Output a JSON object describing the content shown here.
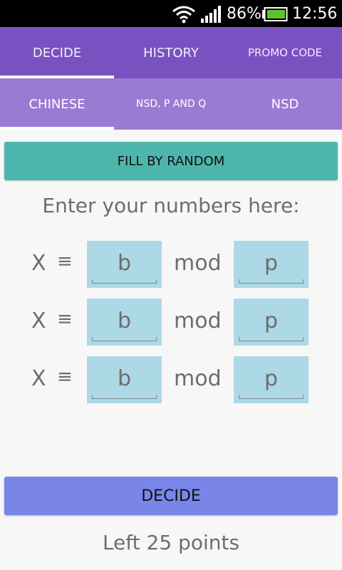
{
  "status_bar": {
    "battery_percent": "86%",
    "time": "12:56",
    "icons": [
      "wifi-icon",
      "signal-icon",
      "battery-icon"
    ]
  },
  "top_tabs": [
    {
      "label": "DECIDE",
      "active": true
    },
    {
      "label": "HISTORY",
      "active": false
    },
    {
      "label": "PROMO CODE",
      "active": false
    }
  ],
  "sub_tabs": [
    {
      "label": "CHINESE",
      "active": true
    },
    {
      "label": "NSD, P AND Q",
      "active": false
    },
    {
      "label": "NSD",
      "active": false
    }
  ],
  "fill_button": {
    "label": "FILL BY RANDOM"
  },
  "instructions": "Enter your numbers here:",
  "equations": [
    {
      "variable": "X",
      "symbol": "≡",
      "b_placeholder": "b",
      "mod_label": "mod",
      "p_placeholder": "p"
    },
    {
      "variable": "X",
      "symbol": "≡",
      "b_placeholder": "b",
      "mod_label": "mod",
      "p_placeholder": "p"
    },
    {
      "variable": "X",
      "symbol": "≡",
      "b_placeholder": "b",
      "mod_label": "mod",
      "p_placeholder": "p"
    }
  ],
  "decide_button": {
    "label": "DECIDE"
  },
  "points_text": "Left 25 points",
  "colors": {
    "top_tabs_bg": "#7a51c1",
    "sub_tabs_bg": "#9b7ad3",
    "fill_button": "#4db6ac",
    "decide_button": "#7986e8",
    "input_bg": "#add8e6"
  }
}
